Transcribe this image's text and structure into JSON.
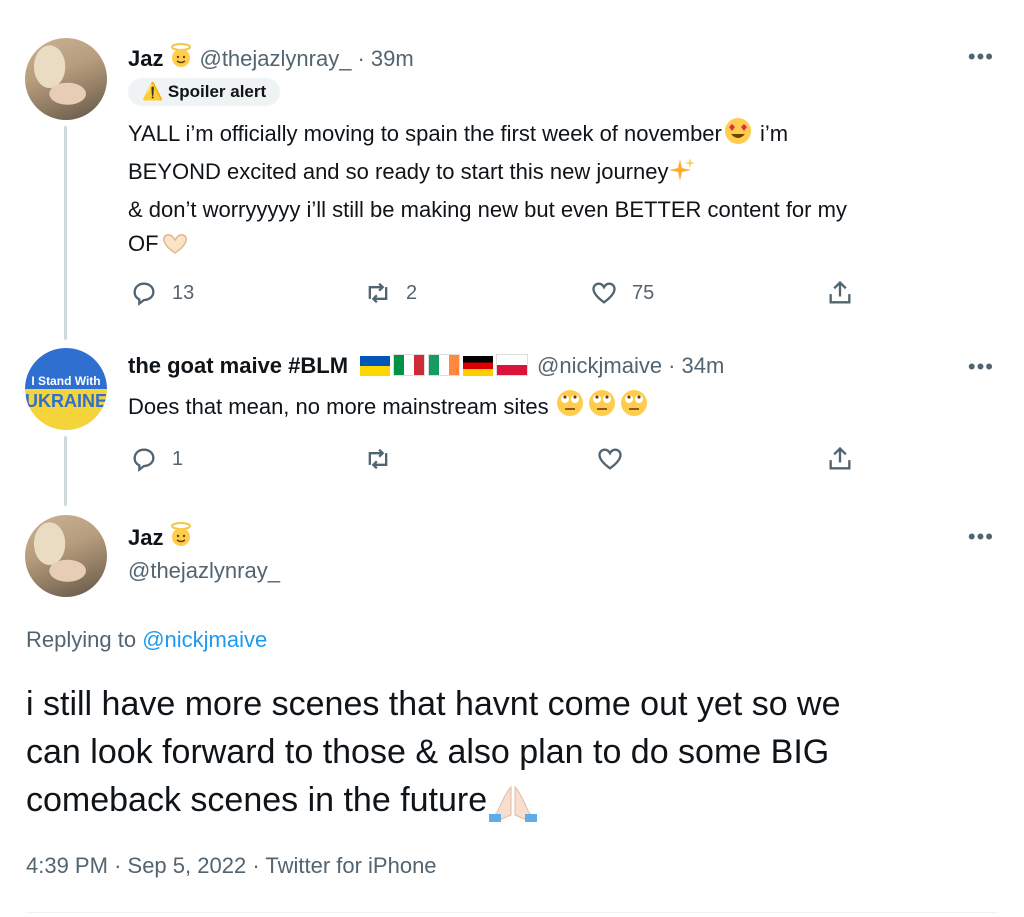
{
  "tweet1": {
    "name": "Jaz",
    "handle": "@thejazlynray_",
    "time": "· 39m",
    "spoiler": "Spoiler alert",
    "text_lines": [
      "YALL i’m officially moving to spain the first week of november",
      "i’m",
      "BEYOND excited and so ready to start this new journey",
      "& don’t worryyyyy i’ll still be making new but even BETTER content for my",
      "OF"
    ],
    "replies": "13",
    "retweets": "2",
    "likes": "75"
  },
  "tweet2": {
    "name": "the goat maive #BLM",
    "handle": "@nickjmaive",
    "time": "· 34m",
    "avatar_text_top": "I Stand With",
    "avatar_text_bottom": "UKRAINE",
    "text": "Does that mean, no more mainstream sites",
    "replies": "1"
  },
  "main": {
    "name": "Jaz",
    "handle": "@thejazlynray_",
    "replying_prefix": "Replying to ",
    "replying_handle": "@nickjmaive",
    "text_lines": [
      "i still have more scenes that havnt come out yet so we",
      "can look forward to those & also plan to do some BIG",
      "comeback scenes in the future"
    ],
    "time": "4:39 PM",
    "date": "Sep 5, 2022",
    "source": "Twitter for iPhone"
  },
  "more_label": "•••",
  "colors": {
    "link": "#1d9bf0",
    "muted": "#536471",
    "thread": "#cfd9de"
  }
}
